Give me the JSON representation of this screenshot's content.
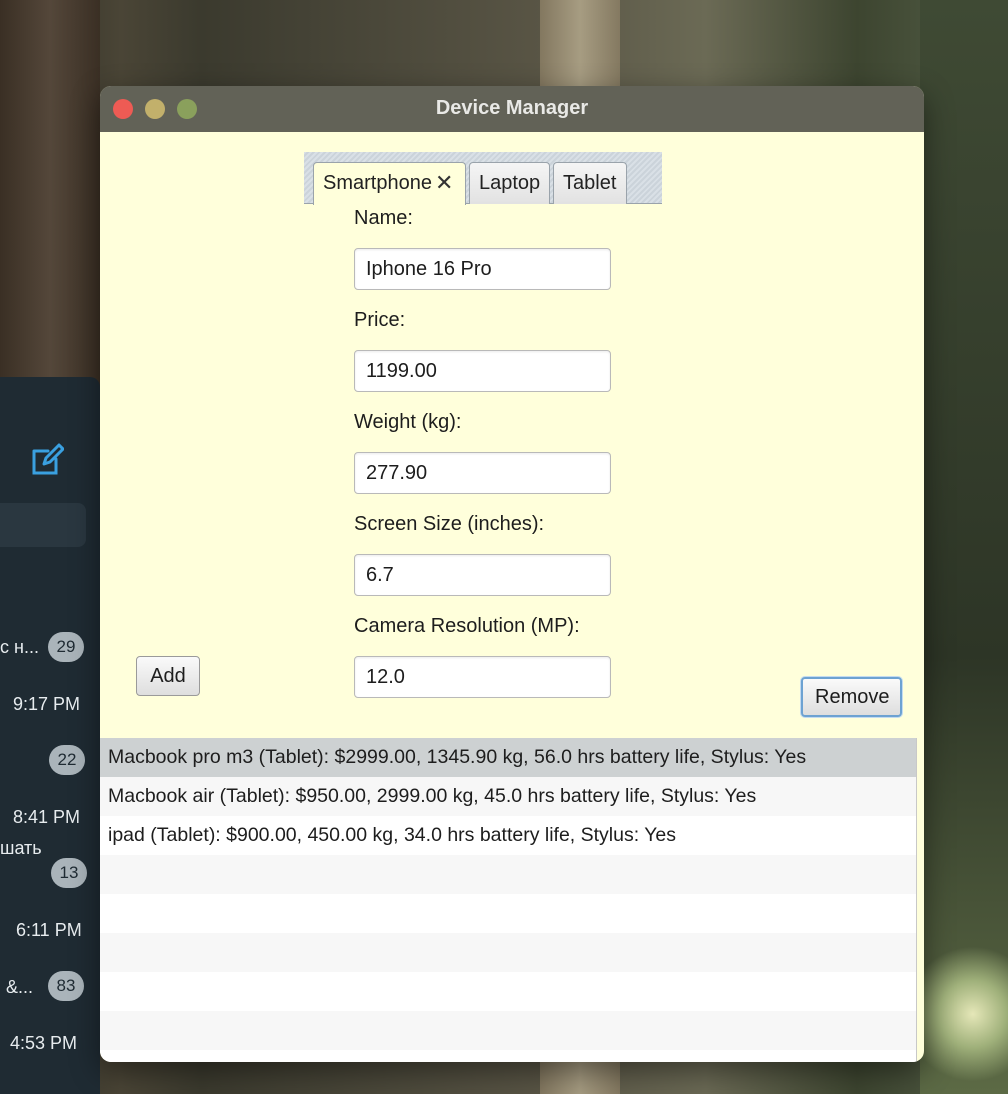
{
  "window": {
    "title": "Device Manager"
  },
  "tabs": [
    {
      "label": "Smartphone",
      "closable": true,
      "active": true
    },
    {
      "label": "Laptop",
      "closable": false,
      "active": false
    },
    {
      "label": "Tablet",
      "closable": false,
      "active": false
    }
  ],
  "tab_close_glyph": "✕",
  "form": {
    "name_label": "Name:",
    "name_value": "Iphone 16 Pro",
    "price_label": "Price:",
    "price_value": "1199.00",
    "weight_label": "Weight (kg):",
    "weight_value": "277.90",
    "screen_label": "Screen Size (inches):",
    "screen_value": "6.7",
    "camera_label": "Camera Resolution (MP):",
    "camera_value": "12.0"
  },
  "buttons": {
    "add": "Add",
    "remove": "Remove"
  },
  "device_list": [
    "Macbook pro m3 (Tablet): $2999.00, 1345.90 kg, 56.0 hrs battery life, Stylus: Yes",
    "Macbook air (Tablet): $950.00, 2999.00 kg, 45.0 hrs battery life, Stylus: Yes",
    "ipad (Tablet): $900.00, 450.00 kg, 34.0 hrs battery life, Stylus: Yes",
    "",
    "",
    "",
    "",
    ""
  ],
  "background_app": {
    "compose_icon": "compose-icon",
    "snippets": [
      "с н...",
      "9:17 PM",
      "8:41 PM",
      "шать",
      "6:11 PM",
      "&...",
      "4:53 PM"
    ],
    "badges": [
      "29",
      "22",
      "13",
      "83"
    ]
  },
  "colors": {
    "window_bg": "#ffffdb",
    "titlebar": "#626257",
    "selected_row": "#cdd1d2",
    "focus_ring": "#6da2d2"
  }
}
